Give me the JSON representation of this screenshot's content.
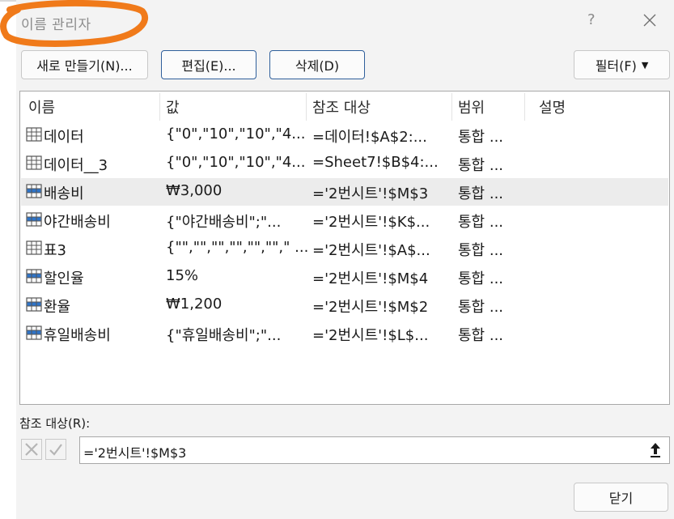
{
  "dialog": {
    "title": "이름 관리자",
    "help": "?"
  },
  "toolbar": {
    "new_label": "새로 만들기(N)...",
    "edit_label": "편집(E)...",
    "delete_label": "삭제(D)",
    "filter_label": "필터(F)"
  },
  "list": {
    "headers": {
      "name": "이름",
      "value": "값",
      "refers_to": "참조 대상",
      "scope": "범위",
      "comment": "설명"
    },
    "rows": [
      {
        "icon": "table-icon",
        "name": "데이터",
        "value": "{\"0\",\"10\",\"10\",\"4...",
        "refers_to": "=데이터!$A$2:...",
        "scope": "통합 ..."
      },
      {
        "icon": "table-icon",
        "name": "데이터__3",
        "value": "{\"0\",\"10\",\"10\",\"4...",
        "refers_to": "=Sheet7!$B$4:...",
        "scope": "통합 ..."
      },
      {
        "icon": "named-range-icon",
        "name": "배송비",
        "value": " ₩3,000",
        "refers_to": "='2번시트'!$M$3",
        "scope": "통합 ...",
        "selected": true
      },
      {
        "icon": "named-range-icon",
        "name": "야간배송비",
        "value": "{\"야간배송비\";\"...",
        "refers_to": "='2번시트'!$K$...",
        "scope": "통합 ..."
      },
      {
        "icon": "table-icon",
        "name": "표3",
        "value": "{\"\",\"\",\"\",\"\",\"\",\"\",\" ...",
        "refers_to": "='2번시트'!$A$...",
        "scope": "통합 ..."
      },
      {
        "icon": "named-range-icon",
        "name": "할인율",
        "value": "15%",
        "refers_to": "='2번시트'!$M$4",
        "scope": "통합 ..."
      },
      {
        "icon": "named-range-icon",
        "name": "환율",
        "value": " ₩1,200",
        "refers_to": "='2번시트'!$M$2",
        "scope": "통합 ..."
      },
      {
        "icon": "named-range-icon",
        "name": "휴일배송비",
        "value": "{\"휴일배송비\";\"...",
        "refers_to": "='2번시트'!$L$...",
        "scope": "통합 ..."
      }
    ]
  },
  "refers_to_section": {
    "label": "참조 대상(R):",
    "value": "='2번시트'!$M$3"
  },
  "footer": {
    "close_label": "닫기"
  },
  "colors": {
    "annotation": "#f07a1a",
    "primary_border": "#2f5f9b",
    "range_icon_blue": "#2e74c8"
  }
}
